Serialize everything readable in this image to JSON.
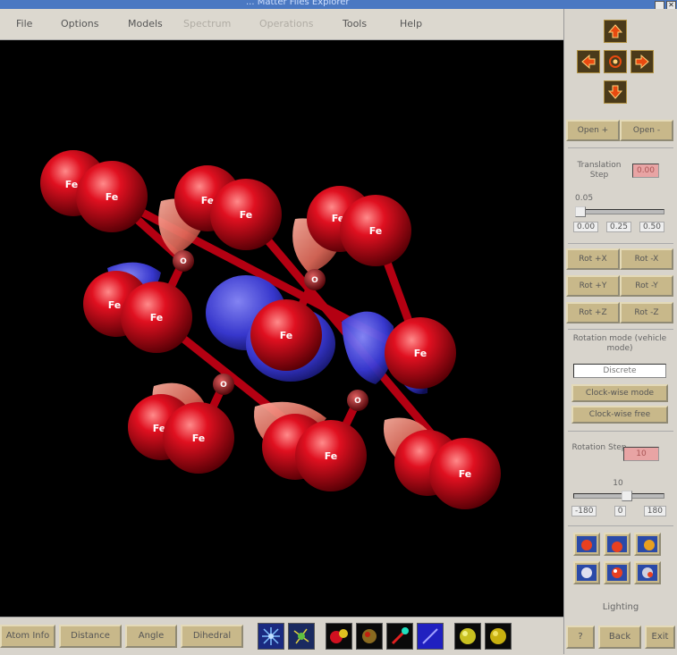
{
  "window": {
    "title": "... Matter Files Explorer"
  },
  "menu": [
    "File",
    "Options",
    "Models",
    "Spectrum",
    "Operations",
    "Tools",
    "Help"
  ],
  "panel": {
    "open_buttons": [
      "Open +",
      "Open -"
    ],
    "translation": {
      "label": "Translation Step",
      "value": "0.00",
      "slider_value": "0.05",
      "ticks": [
        "0.00",
        "0.25",
        "0.50"
      ]
    },
    "rotation_axis_buttons": [
      [
        "Rot +X",
        "Rot -X"
      ],
      [
        "Rot +Y",
        "Rot -Y"
      ],
      [
        "Rot +Z",
        "Rot -Z"
      ]
    ],
    "rotation_mode": {
      "label": "Rotation mode (vehicle mode)",
      "value": "Discrete",
      "buttons": [
        "Clock-wise mode",
        "Clock-wise free"
      ]
    },
    "rotation_step": {
      "label": "Rotation Step",
      "value": "10",
      "slider_value": "10",
      "ticks": [
        "-180",
        "0",
        "180"
      ]
    },
    "lighting_label": "Lighting",
    "footer_buttons": [
      "?",
      "Back",
      "Exit"
    ]
  },
  "bottom": {
    "buttons": [
      "Atom Info",
      "Distance",
      "Angle",
      "Dihedral"
    ]
  },
  "scene": {
    "fe_label": "Fe",
    "o_label": "O",
    "colors": {
      "fe": "#d40010",
      "o": "#9a0008",
      "bond": "#b00010",
      "iso_positive": "#f08070",
      "iso_negative": "#4848e0"
    }
  }
}
